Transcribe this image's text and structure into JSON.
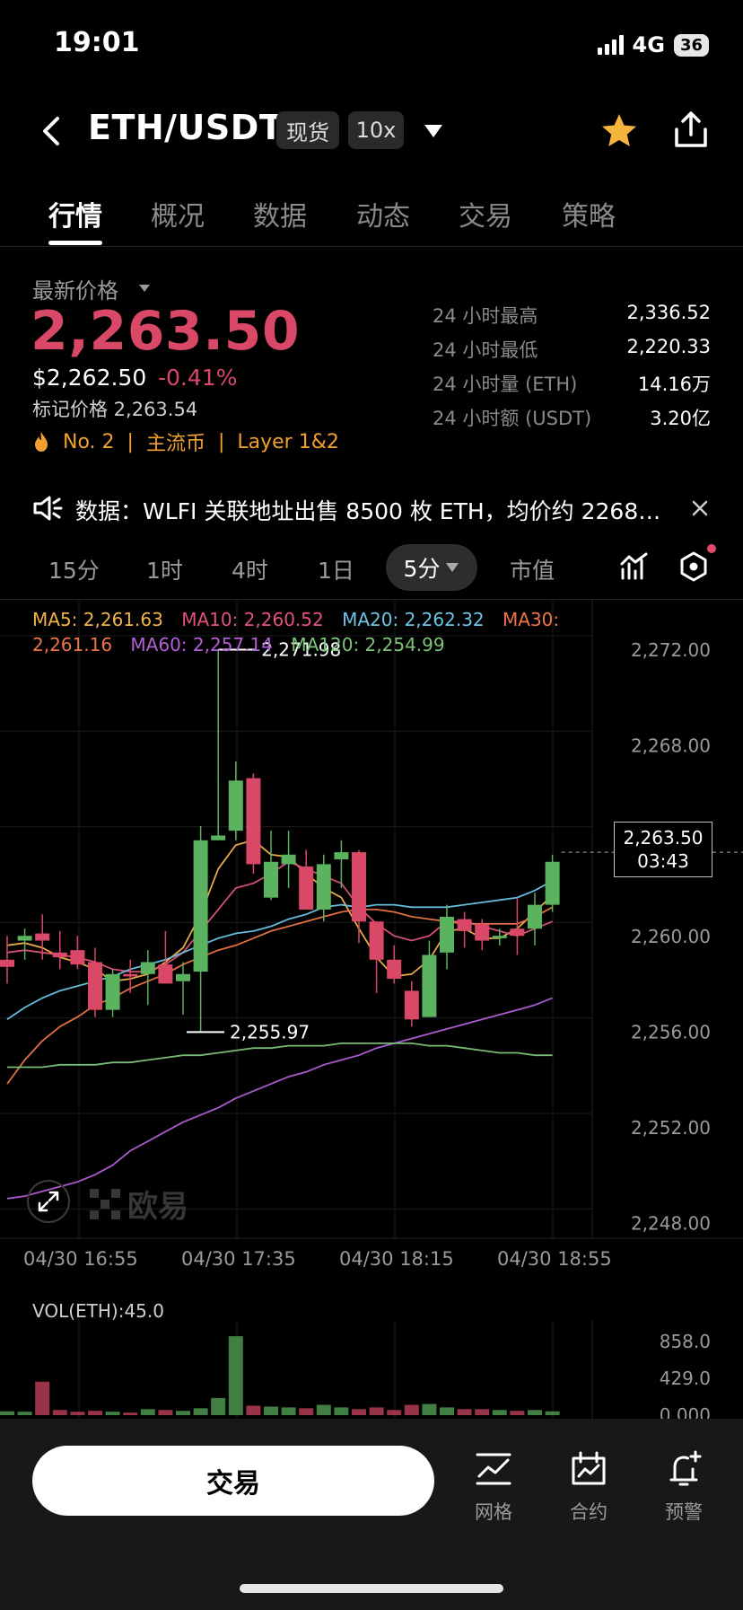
{
  "status_bar": {
    "time": "19:01",
    "network": "4G",
    "battery": "36"
  },
  "header": {
    "pair": "ETH/USDT",
    "market_tag": "现货",
    "leverage_tag": "10x"
  },
  "tabs": [
    "行情",
    "概况",
    "数据",
    "动态",
    "交易",
    "策略"
  ],
  "price": {
    "latest_label": "最新价格",
    "last": "2,263.50",
    "usd": "$2,262.50",
    "change": "-0.41%",
    "mark": "标记价格 2,263.54",
    "rank": "No. 2",
    "tag1": "主流币",
    "tag2": "Layer 1&2"
  },
  "stats": [
    {
      "label": "24 小时最高",
      "value": "2,336.52"
    },
    {
      "label": "24 小时最低",
      "value": "2,220.33"
    },
    {
      "label": "24 小时量 (ETH)",
      "value": "14.16万"
    },
    {
      "label": "24 小时额 (USDT)",
      "value": "3.20亿"
    }
  ],
  "announcement": "数据：WLFI 关联地址出售 8500 枚 ETH，均价约 2268…",
  "intervals": [
    "15分",
    "1时",
    "4时",
    "1日",
    "5分",
    "市值"
  ],
  "ma_legend": [
    {
      "text": "MA5: 2,261.63",
      "color": "#f2b24a"
    },
    {
      "text": "MA10: 2,260.52",
      "color": "#e2537a"
    },
    {
      "text": "MA20: 2,262.32",
      "color": "#6cc4e6"
    },
    {
      "text": "MA30: 2,261.16",
      "color": "#ee7447"
    },
    {
      "text": "MA60: 2,257.14",
      "color": "#b45fd8"
    },
    {
      "text": "MA120: 2,254.99",
      "color": "#7cc47a"
    }
  ],
  "chart_data": {
    "type": "candlestick",
    "y_ticks": [
      "2,272.00",
      "2,268.00",
      "2,264.00",
      "2,260.00",
      "2,256.00",
      "2,252.00",
      "2,248.00"
    ],
    "ylim": [
      2248,
      2272
    ],
    "x_ticks": [
      "04/30 16:55",
      "04/30 17:35",
      "04/30 18:15",
      "04/30 18:55"
    ],
    "high_marker": "2,271.98",
    "low_marker": "2,255.97",
    "current_price": "2,263.50",
    "countdown": "03:43",
    "candles": [
      [
        2259.0,
        2260.0,
        2258.0,
        2258.7
      ],
      [
        2259.8,
        2260.3,
        2259.0,
        2260.0
      ],
      [
        2260.1,
        2260.9,
        2259.0,
        2259.8
      ],
      [
        2259.3,
        2260.2,
        2258.6,
        2259.1
      ],
      [
        2259.4,
        2260.0,
        2258.6,
        2258.8
      ],
      [
        2258.9,
        2259.5,
        2256.6,
        2256.9
      ],
      [
        2256.9,
        2258.6,
        2256.6,
        2258.4
      ],
      [
        2258.4,
        2259.0,
        2257.6,
        2258.3
      ],
      [
        2258.4,
        2259.4,
        2257.1,
        2258.9
      ],
      [
        2258.8,
        2260.2,
        2258.0,
        2258.0
      ],
      [
        2258.1,
        2258.9,
        2256.7,
        2258.4
      ],
      [
        2258.5,
        2264.6,
        2256.0,
        2264.0
      ],
      [
        2264.0,
        2272.0,
        2264.0,
        2264.2
      ],
      [
        2264.4,
        2267.3,
        2264.0,
        2266.5
      ],
      [
        2266.6,
        2266.8,
        2262.6,
        2263.0
      ],
      [
        2261.6,
        2264.4,
        2261.5,
        2263.1
      ],
      [
        2263.0,
        2264.4,
        2262.0,
        2263.4
      ],
      [
        2262.9,
        2263.6,
        2261.2,
        2261.1
      ],
      [
        2261.1,
        2263.4,
        2260.6,
        2263.0
      ],
      [
        2263.2,
        2264.0,
        2262.0,
        2263.5
      ],
      [
        2263.5,
        2263.6,
        2259.7,
        2260.6
      ],
      [
        2260.6,
        2260.6,
        2257.6,
        2259.0
      ],
      [
        2259.0,
        2259.6,
        2258.0,
        2258.2
      ],
      [
        2257.7,
        2258.1,
        2256.2,
        2256.5
      ],
      [
        2256.6,
        2259.8,
        2256.6,
        2259.2
      ],
      [
        2259.3,
        2261.3,
        2258.6,
        2260.8
      ],
      [
        2260.7,
        2261.0,
        2259.5,
        2260.2
      ],
      [
        2260.5,
        2260.7,
        2259.4,
        2259.8
      ],
      [
        2259.9,
        2260.3,
        2259.6,
        2260.0
      ],
      [
        2260.3,
        2261.6,
        2259.2,
        2260.0
      ],
      [
        2260.3,
        2261.8,
        2259.6,
        2261.3
      ],
      [
        2261.3,
        2263.4,
        2261.0,
        2263.1
      ]
    ],
    "series": [
      {
        "name": "MA5",
        "color": "#f2b24a",
        "values": [
          2259.6,
          2259.7,
          2259.5,
          2259.1,
          2258.9,
          2258.6,
          2258.1,
          2258.2,
          2258.4,
          2258.9,
          2259.5,
          2260.9,
          2262.8,
          2263.8,
          2264.0,
          2263.4,
          2263.3,
          2262.6,
          2262.0,
          2261.6,
          2260.3,
          2259.1,
          2258.3,
          2258.4,
          2259.0,
          2260.2,
          2260.3,
          2259.9,
          2259.9,
          2260.3,
          2261.0,
          2261.7
        ]
      },
      {
        "name": "MA10",
        "color": "#e2537a",
        "values": [
          2259.3,
          2259.4,
          2259.3,
          2259.2,
          2259.1,
          2258.9,
          2258.6,
          2258.5,
          2258.5,
          2258.8,
          2259.3,
          2260.2,
          2261.1,
          2262.0,
          2262.2,
          2262.6,
          2263.1,
          2262.8,
          2262.5,
          2262.2,
          2261.2,
          2260.5,
          2260.0,
          2259.8,
          2260.0,
          2260.6,
          2260.6,
          2260.4,
          2260.2,
          2260.0,
          2260.3,
          2260.6
        ]
      },
      {
        "name": "MA20",
        "color": "#6cc4e6",
        "values": [
          2256.5,
          2257.0,
          2257.4,
          2257.7,
          2257.9,
          2258.1,
          2258.3,
          2258.6,
          2258.8,
          2259.0,
          2259.3,
          2259.6,
          2259.9,
          2260.1,
          2260.2,
          2260.4,
          2260.7,
          2260.9,
          2261.2,
          2261.3,
          2261.2,
          2261.3,
          2261.3,
          2261.2,
          2261.2,
          2261.2,
          2261.3,
          2261.4,
          2261.5,
          2261.6,
          2261.9,
          2262.3
        ]
      },
      {
        "name": "MA30",
        "color": "#ee7447",
        "values": [
          2253.8,
          2254.8,
          2255.6,
          2256.2,
          2256.6,
          2257.1,
          2257.4,
          2257.8,
          2258.1,
          2258.4,
          2258.8,
          2259.1,
          2259.4,
          2259.6,
          2259.9,
          2260.2,
          2260.4,
          2260.6,
          2260.8,
          2261.0,
          2261.1,
          2261.1,
          2261.0,
          2260.8,
          2260.7,
          2260.6,
          2260.5,
          2260.5,
          2260.5,
          2260.5,
          2260.8,
          2261.2
        ]
      },
      {
        "name": "MA60",
        "color": "#b45fd8",
        "values": [
          2249.0,
          2249.1,
          2249.3,
          2249.5,
          2249.7,
          2250.0,
          2250.4,
          2251.0,
          2251.4,
          2251.8,
          2252.2,
          2252.5,
          2252.8,
          2253.2,
          2253.5,
          2253.8,
          2254.1,
          2254.3,
          2254.6,
          2254.8,
          2255.0,
          2255.3,
          2255.5,
          2255.7,
          2255.9,
          2256.1,
          2256.3,
          2256.5,
          2256.7,
          2256.9,
          2257.1,
          2257.4
        ]
      },
      {
        "name": "MA120",
        "color": "#7cc47a",
        "values": [
          2254.5,
          2254.5,
          2254.5,
          2254.6,
          2254.6,
          2254.6,
          2254.7,
          2254.7,
          2254.8,
          2254.9,
          2255.0,
          2255.0,
          2255.1,
          2255.2,
          2255.3,
          2255.3,
          2255.4,
          2255.4,
          2255.4,
          2255.5,
          2255.5,
          2255.5,
          2255.5,
          2255.5,
          2255.4,
          2255.4,
          2255.3,
          2255.2,
          2255.1,
          2255.1,
          2255.0,
          2255.0
        ]
      }
    ]
  },
  "volume": {
    "label": "VOL(ETH):45.0",
    "ticks": [
      "858.0",
      "429.0",
      "0.000"
    ],
    "max": 858,
    "values": [
      45,
      40,
      390,
      60,
      40,
      50,
      40,
      30,
      70,
      60,
      50,
      80,
      200,
      920,
      110,
      100,
      90,
      80,
      120,
      90,
      70,
      90,
      60,
      120,
      130,
      90,
      70,
      70,
      60,
      50,
      60,
      45
    ],
    "up": [
      true,
      true,
      false,
      false,
      false,
      false,
      true,
      false,
      true,
      false,
      true,
      true,
      true,
      true,
      false,
      true,
      true,
      false,
      true,
      true,
      false,
      false,
      false,
      false,
      true,
      true,
      false,
      false,
      true,
      false,
      true,
      true
    ]
  },
  "bottom_bar": {
    "trade": "交易",
    "grid": "网格",
    "contract": "合约",
    "alert": "预警"
  },
  "colors": {
    "up": "#5bb35f",
    "down": "#d94866",
    "accent_star": "#f5b53c"
  }
}
